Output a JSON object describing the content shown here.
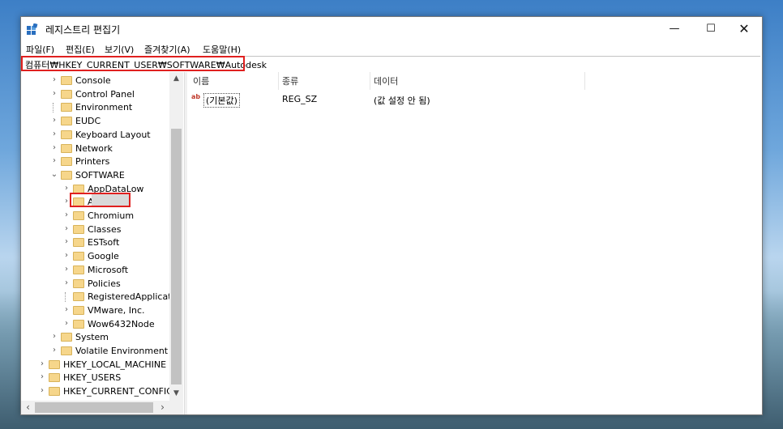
{
  "window": {
    "title": "레지스트리 편집기",
    "minimize": "—",
    "maximize": "☐",
    "close": "✕"
  },
  "menu": [
    "파일(F)",
    "편집(E)",
    "보기(V)",
    "즐겨찾기(A)",
    "도움말(H)"
  ],
  "address": "컴퓨터₩HKEY_CURRENT_USER₩SOFTWARE₩Autodesk",
  "tree": [
    {
      "label": "Console",
      "indent": 1,
      "chev": "›"
    },
    {
      "label": "Control Panel",
      "indent": 1,
      "chev": "›"
    },
    {
      "label": "Environment",
      "indent": 1,
      "chev": ""
    },
    {
      "label": "EUDC",
      "indent": 1,
      "chev": "›"
    },
    {
      "label": "Keyboard Layout",
      "indent": 1,
      "chev": "›"
    },
    {
      "label": "Network",
      "indent": 1,
      "chev": "›"
    },
    {
      "label": "Printers",
      "indent": 1,
      "chev": "›"
    },
    {
      "label": "SOFTWARE",
      "indent": 1,
      "chev": "⌄"
    },
    {
      "label": "AppDataLow",
      "indent": 2,
      "chev": "›"
    },
    {
      "label": "Autodesk",
      "indent": 2,
      "chev": "›"
    },
    {
      "label": "Chromium",
      "indent": 2,
      "chev": "›"
    },
    {
      "label": "Classes",
      "indent": 2,
      "chev": "›"
    },
    {
      "label": "ESTsoft",
      "indent": 2,
      "chev": "›"
    },
    {
      "label": "Google",
      "indent": 2,
      "chev": "›"
    },
    {
      "label": "Microsoft",
      "indent": 2,
      "chev": "›"
    },
    {
      "label": "Policies",
      "indent": 2,
      "chev": "›"
    },
    {
      "label": "RegisteredApplicatic",
      "indent": 2,
      "chev": ""
    },
    {
      "label": "VMware, Inc.",
      "indent": 2,
      "chev": "›"
    },
    {
      "label": "Wow6432Node",
      "indent": 2,
      "chev": "›"
    },
    {
      "label": "System",
      "indent": 1,
      "chev": "›"
    },
    {
      "label": "Volatile Environment",
      "indent": 1,
      "chev": "›"
    },
    {
      "label": "HKEY_LOCAL_MACHINE",
      "indent": 0,
      "chev": "›"
    },
    {
      "label": "HKEY_USERS",
      "indent": 0,
      "chev": "›"
    },
    {
      "label": "HKEY_CURRENT_CONFIG",
      "indent": 0,
      "chev": "›"
    }
  ],
  "selected_key": "Autodesk",
  "list": {
    "headers": [
      "이름",
      "종류",
      "데이터"
    ],
    "rows": [
      {
        "icon": "ab",
        "name": "(기본값)",
        "type": "REG_SZ",
        "data": "(값 설정 안 됨)"
      }
    ]
  },
  "colors": {
    "highlight": "#e0201f",
    "folder": "#f6d68b"
  }
}
